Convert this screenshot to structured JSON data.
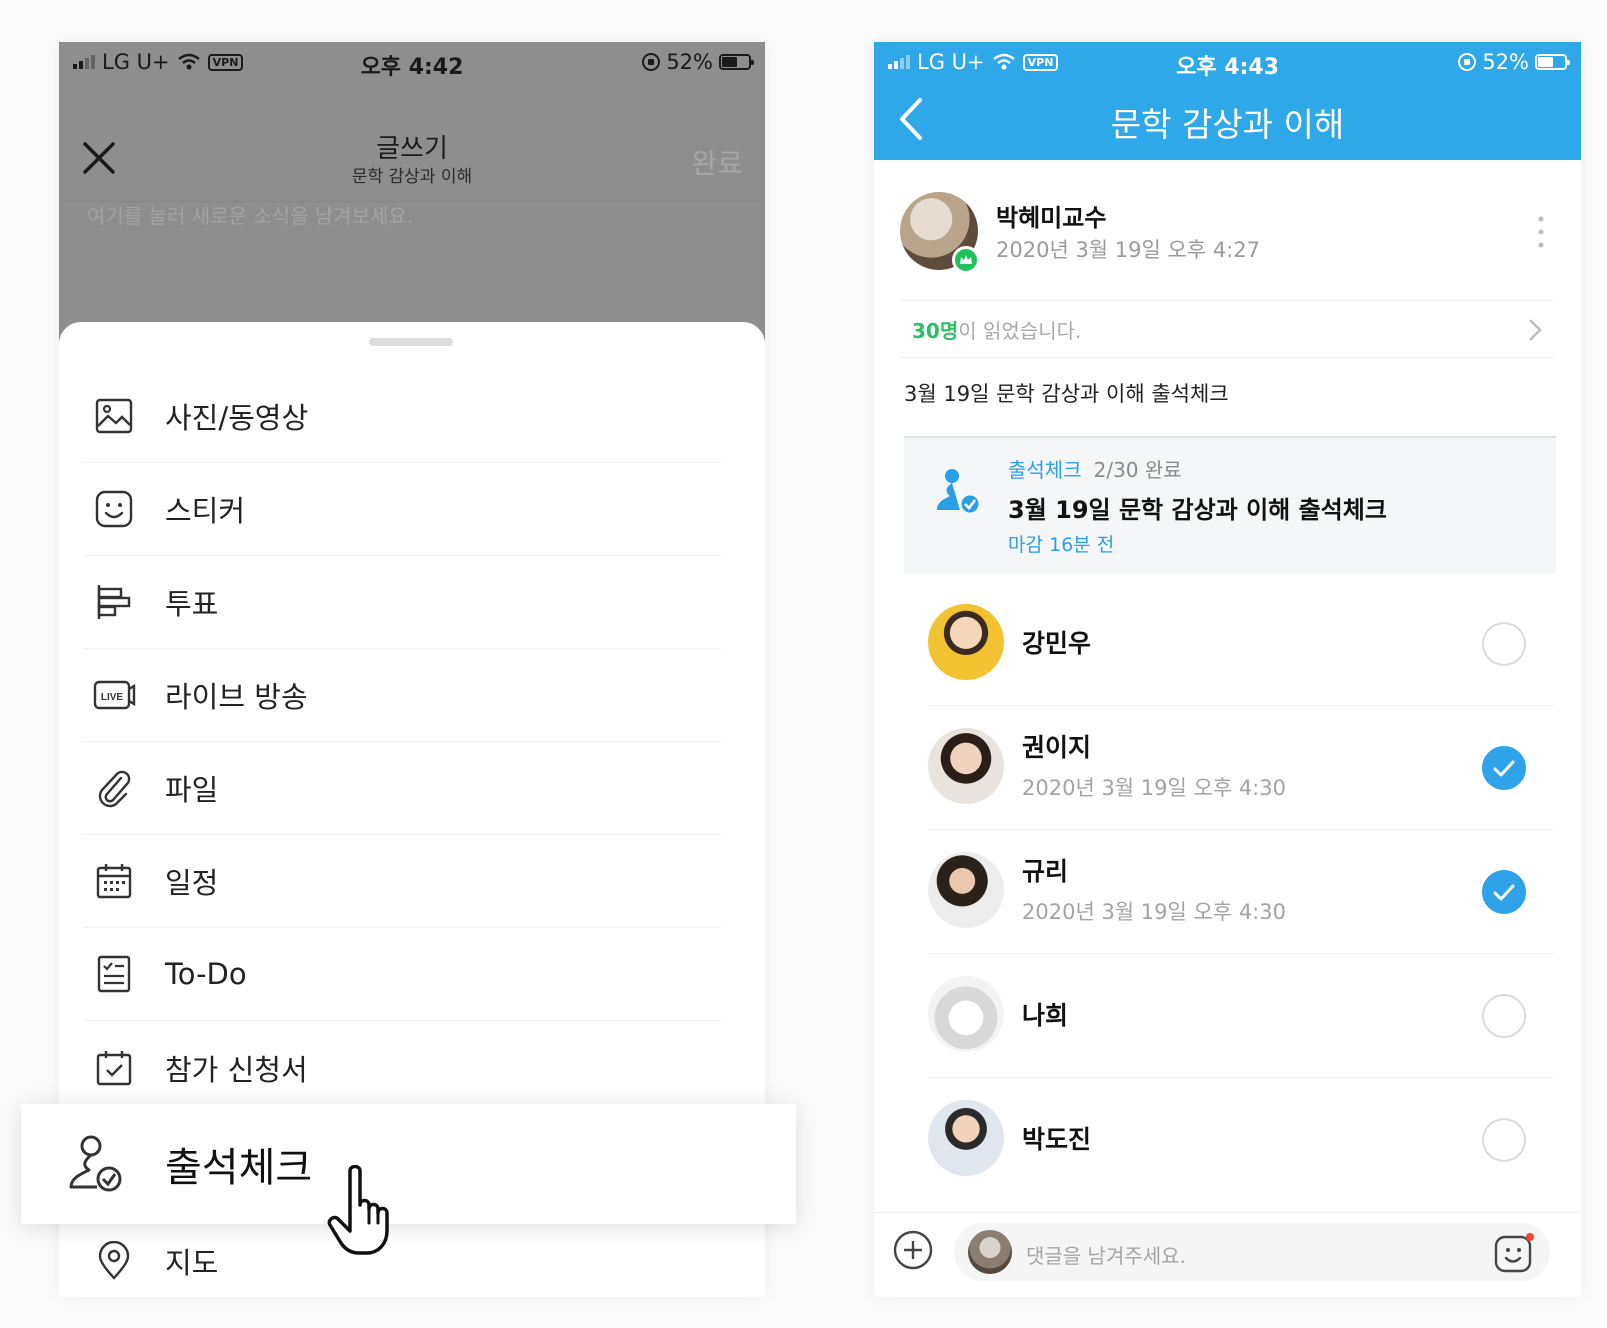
{
  "left": {
    "status": {
      "carrier": "LG U+",
      "vpn": "VPN",
      "time": "오후 4:42",
      "battery": "52%",
      "battery_level": 0.52
    },
    "header": {
      "title": "글쓰기",
      "subtitle": "문학 감상과 이해",
      "done": "완료"
    },
    "placeholder": "여기를 눌러 새로운 소식을 남겨보세요.",
    "menu": [
      {
        "label": "사진/동영상",
        "icon": "image-icon"
      },
      {
        "label": "스티커",
        "icon": "sticker-icon"
      },
      {
        "label": "투표",
        "icon": "poll-icon"
      },
      {
        "label": "라이브 방송",
        "icon": "live-icon"
      },
      {
        "label": "파일",
        "icon": "paperclip-icon"
      },
      {
        "label": "일정",
        "icon": "calendar-icon"
      },
      {
        "label": "To-Do",
        "icon": "todo-icon"
      },
      {
        "label": "참가 신청서",
        "icon": "signup-form-icon"
      },
      {
        "label": "출석체크",
        "icon": "attendance-icon"
      },
      {
        "label": "지도",
        "icon": "map-pin-icon"
      }
    ]
  },
  "right": {
    "status": {
      "carrier": "LG U+",
      "vpn": "VPN",
      "time": "오후 4:43",
      "battery": "52%",
      "battery_level": 0.52
    },
    "header": {
      "title": "문학 감상과 이해"
    },
    "post": {
      "author": "박혜미교수",
      "date": "2020년 3월 19일 오후 4:27",
      "readers_count": "30명",
      "readers_suffix": "이 읽었습니다.",
      "body": "3월 19일 문학 감상과 이해 출석체크"
    },
    "attendance": {
      "kind": "출석체크",
      "progress": "2/30 완료",
      "title": "3월 19일 문학 감상과 이해 출석체크",
      "deadline": "마감 16분 전"
    },
    "members": [
      {
        "name": "강민우",
        "date": "",
        "checked": false
      },
      {
        "name": "권이지",
        "date": "2020년 3월 19일 오후 4:30",
        "checked": true
      },
      {
        "name": "규리",
        "date": "2020년 3월 19일 오후 4:30",
        "checked": true
      },
      {
        "name": "나희",
        "date": "",
        "checked": false
      },
      {
        "name": "박도진",
        "date": "",
        "checked": false
      }
    ],
    "comment": {
      "placeholder": "댓글을 남겨주세요."
    }
  },
  "colors": {
    "accent_blue": "#2fa8ea",
    "read_green": "#2cc067",
    "dim_overlay": "#8e8e8e"
  }
}
